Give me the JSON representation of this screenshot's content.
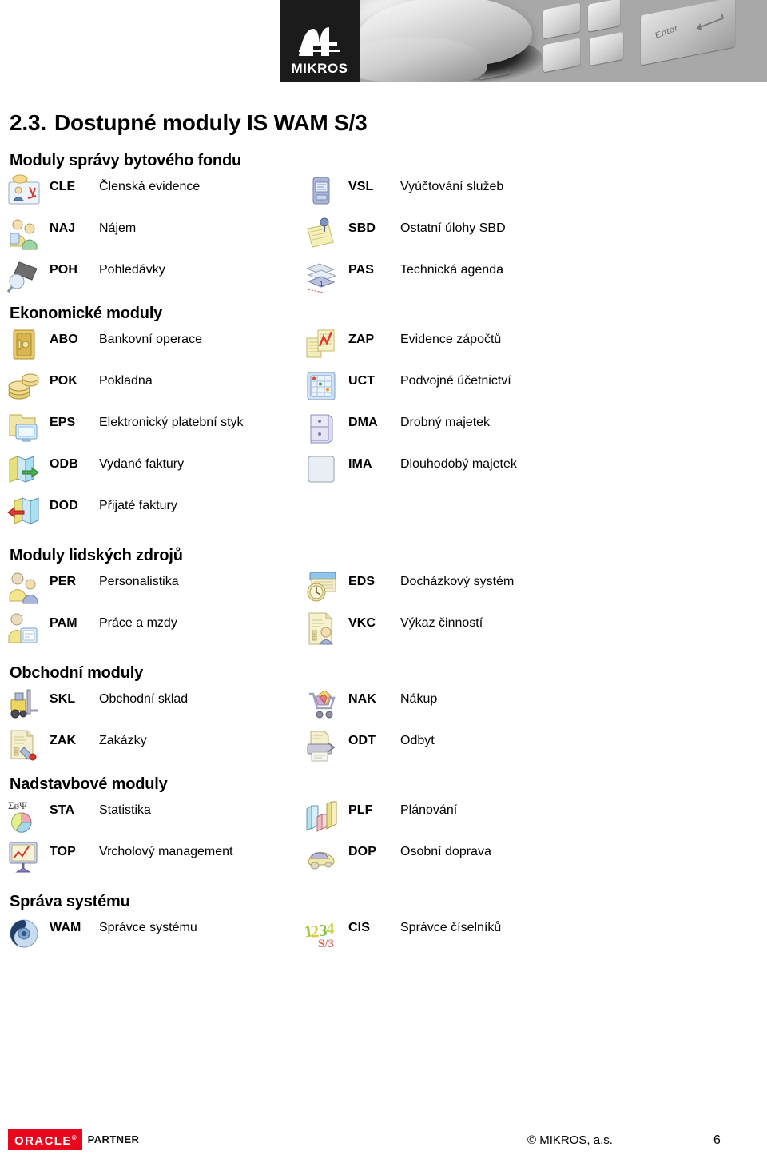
{
  "header": {
    "logo_text": "MIKROS",
    "logo_mark": "mikros-m-icon",
    "banner_image": "keyboard-finger-photo",
    "enter_key_label": "Enter"
  },
  "title": {
    "number": "2.3.",
    "text": "Dostupné moduly IS WAM S/3"
  },
  "sections": [
    {
      "heading": "Moduly správy bytového fondu",
      "rows": [
        {
          "left": {
            "icon": "member-card-icon",
            "code": "CLE",
            "label": "Členská evidence"
          },
          "right": {
            "icon": "service-billing-icon",
            "code": "VSL",
            "label": "Vyúčtování služeb"
          }
        },
        {
          "left": {
            "icon": "tenant-people-icon",
            "code": "NAJ",
            "label": "Nájem"
          },
          "right": {
            "icon": "pinned-note-icon",
            "code": "SBD",
            "label": "Ostatní úlohy SBD"
          }
        },
        {
          "left": {
            "icon": "magnifier-stamp-icon",
            "code": "POH",
            "label": "Pohledávky"
          },
          "right": {
            "icon": "blueprint-pages-icon",
            "code": "PAS",
            "label": "Technická agenda"
          }
        }
      ]
    },
    {
      "heading": "Ekonomické moduly",
      "rows": [
        {
          "left": {
            "icon": "safe-vault-icon",
            "code": "ABO",
            "label": "Bankovní operace"
          },
          "right": {
            "icon": "ledger-chart-icon",
            "code": "ZAP",
            "label": "Evidence zápočtů"
          }
        },
        {
          "left": {
            "icon": "coins-icon",
            "code": "POK",
            "label": "Pokladna"
          },
          "right": {
            "icon": "accounting-grid-icon",
            "code": "UCT",
            "label": "Podvojné účetnictví"
          }
        },
        {
          "left": {
            "icon": "folder-monitor-icon",
            "code": "EPS",
            "label": "Elektronický platební styk"
          },
          "right": {
            "icon": "file-cabinet-icon",
            "code": "DMA",
            "label": "Drobný majetek"
          }
        },
        {
          "left": {
            "icon": "books-out-arrow-icon",
            "code": "ODB",
            "label": "Vydané faktury"
          },
          "right": {
            "icon": "house-asset-icon",
            "code": "IMA",
            "label": "Dlouhodobý majetek"
          }
        },
        {
          "left": {
            "icon": "books-in-arrow-icon",
            "code": "DOD",
            "label": "Přijaté faktury"
          },
          "right": null
        }
      ]
    },
    {
      "heading": "Moduly lidských zdrojů",
      "rows": [
        {
          "left": {
            "icon": "two-people-icon",
            "code": "PER",
            "label": "Personalistika"
          },
          "right": {
            "icon": "time-clock-icon",
            "code": "EDS",
            "label": "Docházkový systém"
          }
        },
        {
          "left": {
            "icon": "person-payslip-icon",
            "code": "PAM",
            "label": "Práce a mzdy"
          },
          "right": {
            "icon": "report-person-icon",
            "code": "VKC",
            "label": "Výkaz činností"
          }
        }
      ]
    },
    {
      "heading": "Obchodní moduly",
      "rows": [
        {
          "left": {
            "icon": "forklift-icon",
            "code": "SKL",
            "label": "Obchodní sklad"
          },
          "right": {
            "icon": "shopping-cart-icon",
            "code": "NAK",
            "label": "Nákup"
          }
        },
        {
          "left": {
            "icon": "order-tag-icon",
            "code": "ZAK",
            "label": "Zakázky"
          },
          "right": {
            "icon": "printer-invoice-icon",
            "code": "ODT",
            "label": "Odbyt"
          }
        }
      ]
    },
    {
      "heading": "Nadstavbové moduly",
      "rows": [
        {
          "left": {
            "icon": "statistics-pie-icon",
            "code": "STA",
            "label": "Statistika"
          },
          "right": {
            "icon": "bar-chart-icon",
            "code": "PLF",
            "label": "Plánování"
          }
        },
        {
          "left": {
            "icon": "presentation-chart-icon",
            "code": "TOP",
            "label": "Vrcholový management"
          },
          "right": {
            "icon": "car-icon",
            "code": "DOP",
            "label": "Osobní doprava"
          }
        }
      ]
    },
    {
      "heading": "Správa systému",
      "rows": [
        {
          "left": {
            "icon": "gear-sphere-icon",
            "code": "WAM",
            "label": "Správce systému"
          },
          "right": {
            "icon": "numbers-1234-icon",
            "code": "CIS",
            "label": "Správce číselníků"
          }
        }
      ]
    }
  ],
  "footer": {
    "oracle_label": "ORACLE",
    "partner_label": "PARTNER",
    "copyright": "© MIKROS, a.s.",
    "page_number": "6"
  },
  "colors": {
    "oracle_red": "#e8071c",
    "text": "#000000",
    "banner_dark": "#1b1b1b"
  }
}
